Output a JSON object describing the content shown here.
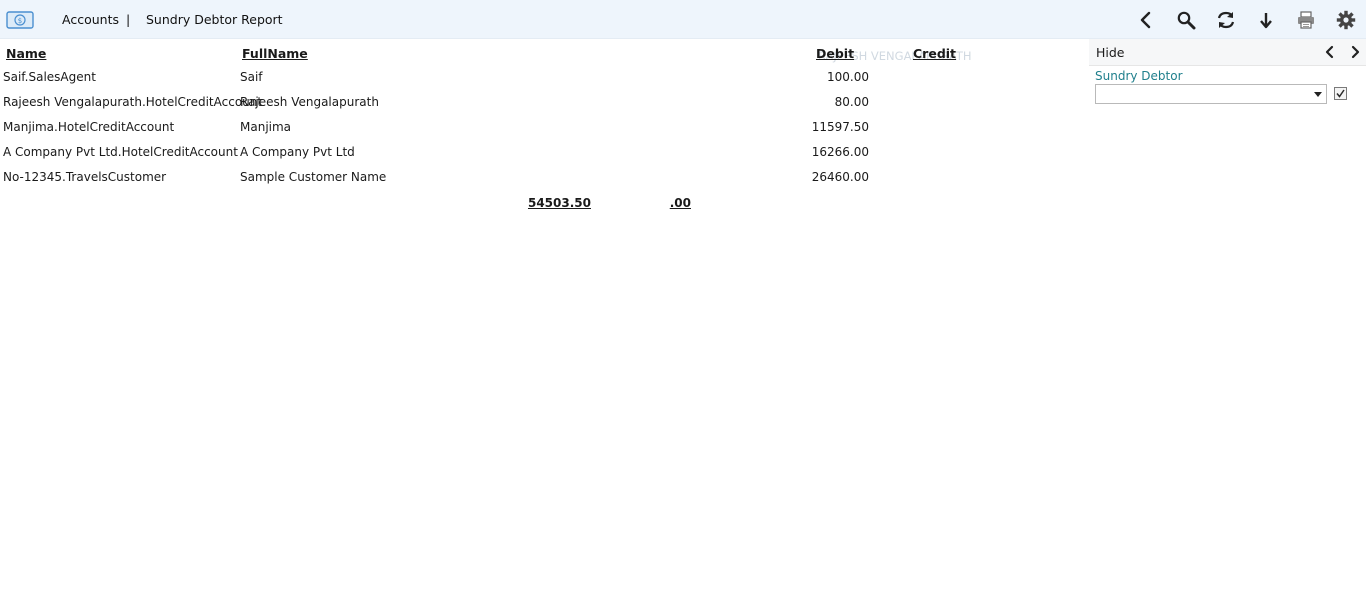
{
  "header": {
    "breadcrumb_accounts": "Accounts",
    "breadcrumb_separator": "|",
    "breadcrumb_report": "Sundry Debtor Report",
    "logo_icon": "money-icon",
    "toolbar_icons": [
      "back-icon",
      "search-icon",
      "refresh-icon",
      "download-icon",
      "print-icon",
      "gear-icon"
    ]
  },
  "table": {
    "columns": {
      "name": "Name",
      "fullname": "FullName",
      "debit": "Debit",
      "credit": "Credit"
    },
    "watermark": "RAJEESH VENGALAPURATH",
    "rows": [
      {
        "name": "Saif.SalesAgent",
        "fullname": "Saif",
        "debit": "100.00"
      },
      {
        "name": "Rajeesh Vengalapurath.HotelCreditAccount",
        "fullname": "Rajeesh Vengalapurath",
        "debit": "80.00"
      },
      {
        "name": "Manjima.HotelCreditAccount",
        "fullname": "Manjima",
        "debit": "11597.50"
      },
      {
        "name": "A Company Pvt Ltd.HotelCreditAccount",
        "fullname": "A Company Pvt Ltd",
        "debit": "16266.00"
      },
      {
        "name": "No-12345.TravelsCustomer",
        "fullname": "Sample Customer Name",
        "debit": "26460.00"
      }
    ],
    "totals": {
      "debit": "54503.50",
      "credit": ".00"
    }
  },
  "sidebar": {
    "hide_label": "Hide",
    "filter_label": "Sundry Debtor",
    "filter_selected": "",
    "filter_checked": true
  },
  "colors": {
    "topbar_bg": "#eef5fc",
    "filter_label": "#1f7f8c",
    "logo": "#4a8fd0"
  }
}
